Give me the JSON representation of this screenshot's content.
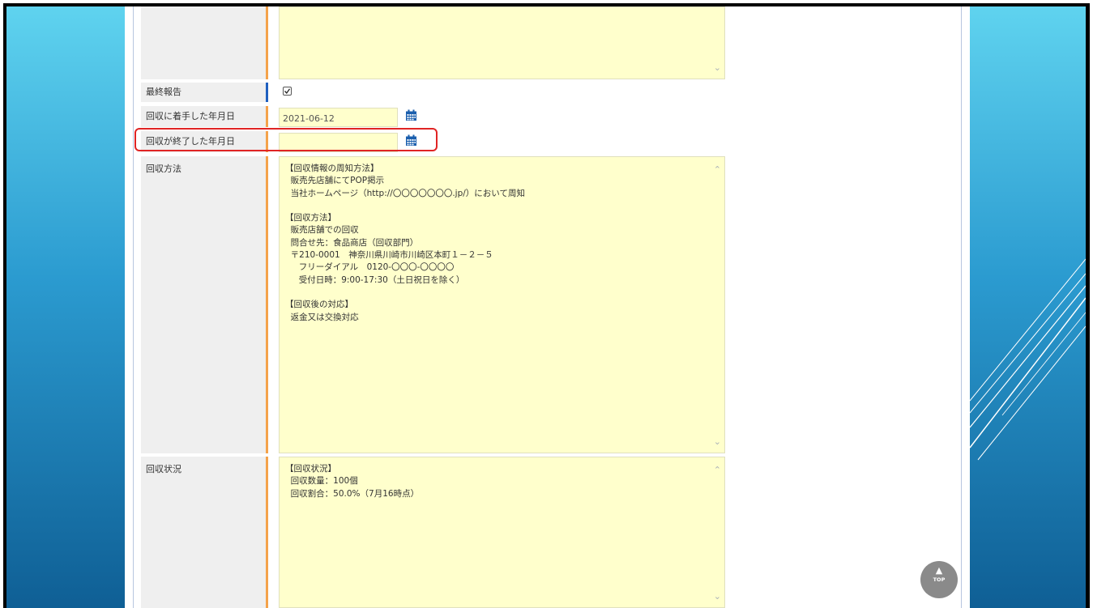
{
  "form": {
    "final_report": {
      "label": "最終報告",
      "checked": true
    },
    "start_date": {
      "label": "回収に着手した年月日",
      "value": "2021-06-12"
    },
    "end_date": {
      "label": "回収が終了した年月日",
      "value": ""
    },
    "method": {
      "label": "回収方法",
      "lines": [
        "【回収情報の周知方法】",
        "  販売先店舗にてPOP掲示",
        "  当社ホームページ（http://〇〇〇〇〇〇〇.jp/）において周知",
        "",
        "【回収方法】",
        "  販売店舗での回収",
        "  問合せ先：食品商店（回収部門）",
        "  〒210-0001　神奈川県川崎市川崎区本町１－２－５",
        "     フリーダイアル　0120-〇〇〇-〇〇〇〇",
        "     受付日時：9:00-17:30（土日祝日を除く）",
        "",
        "【回収後の対応】",
        "  返金又は交換対応"
      ]
    },
    "status": {
      "label": "回収状況",
      "lines": [
        "【回収状況】",
        "  回収数量：100個",
        "  回収割合：50.0%（7月16時点）"
      ]
    }
  },
  "icons": {
    "calendar": "calendar-icon",
    "scroll_up": "chevron-up-icon",
    "scroll_down": "chevron-down-icon",
    "top": "arrow-up-icon"
  },
  "top_button": {
    "label": "TOP",
    "arrow": "▲"
  },
  "colors": {
    "input_bg": "#ffffcc",
    "label_bg": "#efefef",
    "accent_orange": "#f4a24a",
    "accent_blue": "#1f5fbf",
    "highlight_red": "#e02424",
    "slide_gradient_top": "#5fd3ef",
    "slide_gradient_bottom": "#0f5f95"
  }
}
